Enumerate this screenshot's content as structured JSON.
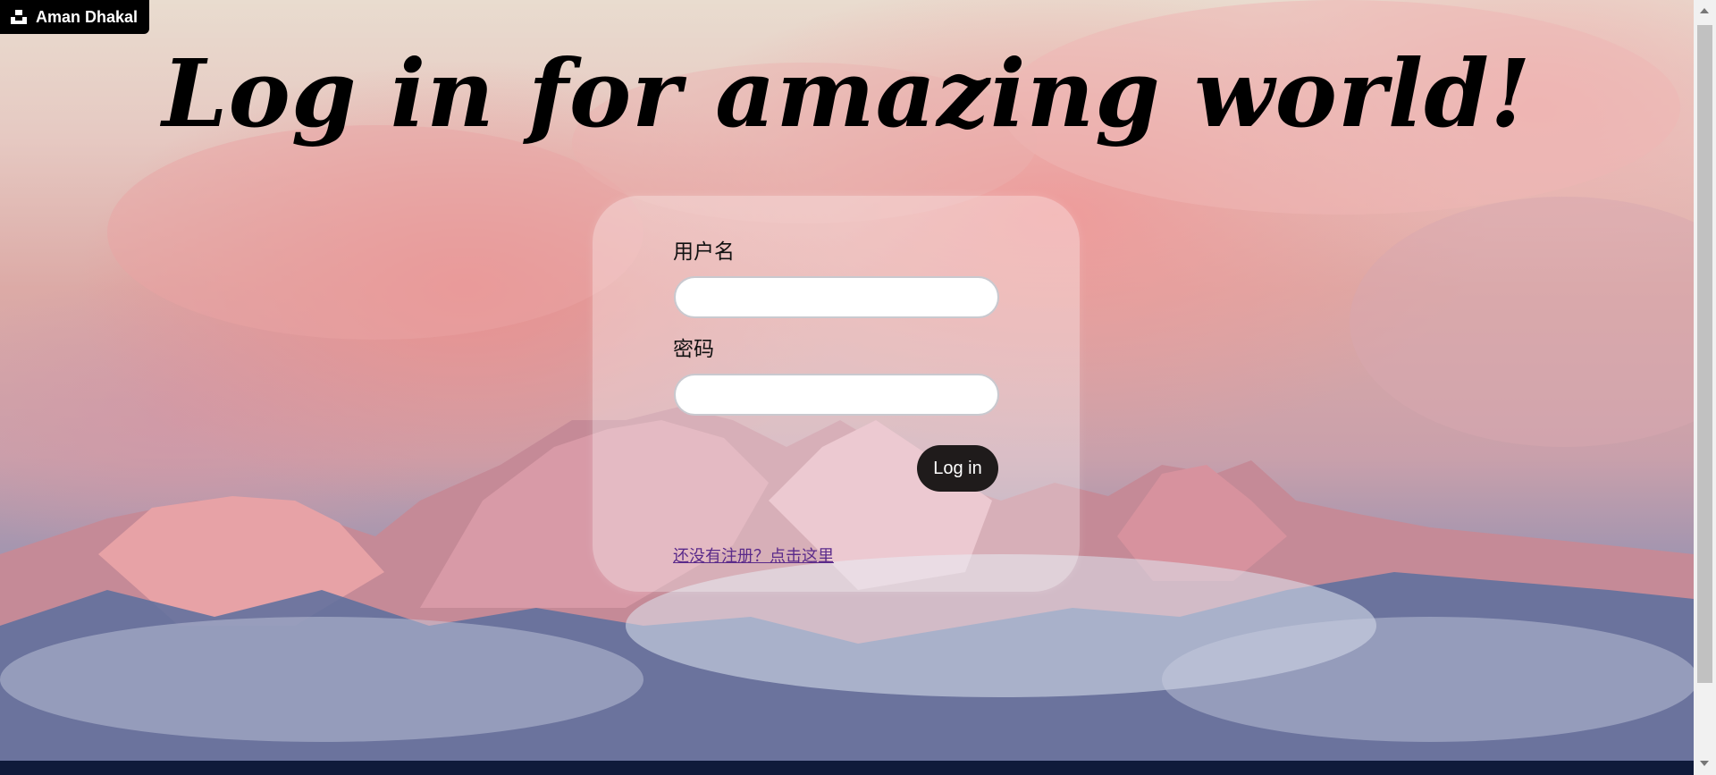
{
  "badge": {
    "name": "Aman Dhakal",
    "icon": "unsplash-logo-icon"
  },
  "headline": "Log in for amazing world!",
  "form": {
    "username_label": "用户名",
    "username_value": "",
    "password_label": "密码",
    "password_value": "",
    "login_button": "Log in",
    "register_link": "还没有注册？点击这里"
  },
  "colors": {
    "button_bg": "#1f1b1b",
    "link": "#5a2a8a",
    "card": "rgba(255,255,255,0.32)"
  }
}
